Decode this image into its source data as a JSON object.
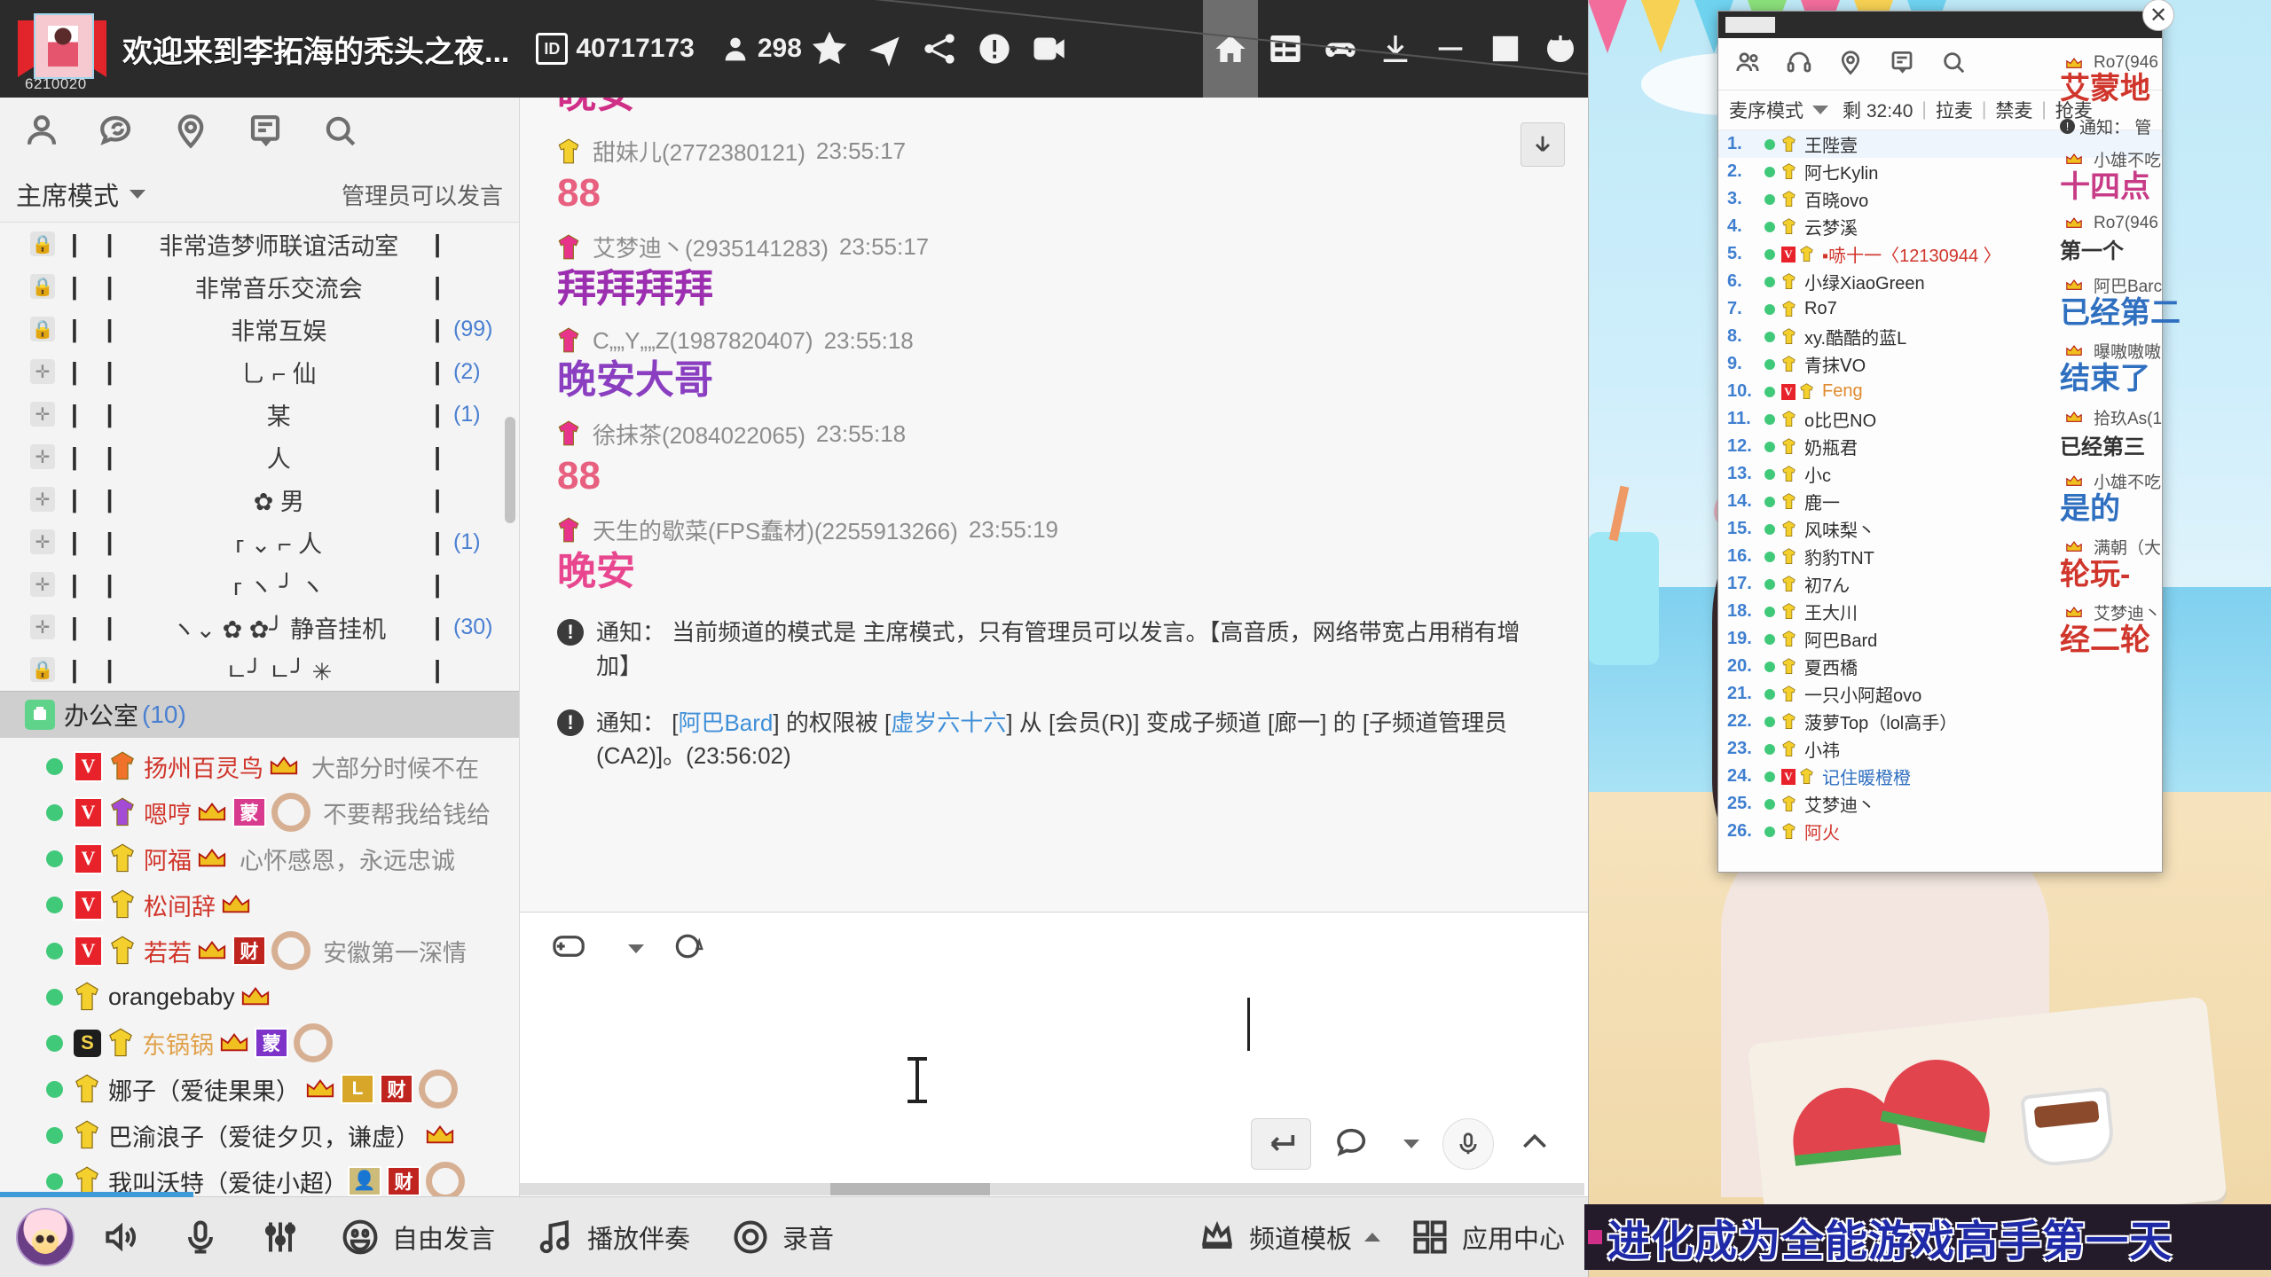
{
  "titlebar": {
    "room_title": "欢迎来到李拓海的秃头之夜...",
    "id_label": "ID",
    "room_id": "40717173",
    "member_count": "298",
    "uid_watermark": "6210020",
    "icons": [
      "star-icon",
      "airplane-icon",
      "share-icon",
      "report-icon",
      "video-icon",
      "home-icon",
      "list-icon",
      "gamepad-icon",
      "download-icon",
      "minimize-icon",
      "maximize-icon",
      "power-icon"
    ]
  },
  "sidebar": {
    "icons": [
      "person-icon",
      "chat-sync-icon",
      "location-pin-icon",
      "note-icon",
      "search-icon"
    ],
    "mode": "主席模式",
    "admin_hint": "管理员可以发言",
    "channels": [
      {
        "lock": "lock",
        "bars": "| |",
        "name": "非常造梦师联谊活动室",
        "tail": "|",
        "count": ""
      },
      {
        "lock": "lock",
        "bars": "| |",
        "name": "非常音乐交流会",
        "tail": "|",
        "count": ""
      },
      {
        "lock": "lock",
        "bars": "| |",
        "name": "非常互娱",
        "tail": "|",
        "count": "(99)"
      },
      {
        "lock": "plus",
        "bars": "| |",
        "name": "乚          ⌐  仙",
        "tail": "|",
        "count": "(2)"
      },
      {
        "lock": "plus",
        "bars": "| |",
        "name": "某",
        "tail": "|",
        "count": "(1)"
      },
      {
        "lock": "plus",
        "bars": "| |",
        "name": "人",
        "tail": "|",
        "count": ""
      },
      {
        "lock": "plus",
        "bars": "| |",
        "name": "✿                男",
        "tail": "|",
        "count": ""
      },
      {
        "lock": "plus",
        "bars": "| |",
        "name": "г  ⌄ ⌐          人",
        "tail": "|",
        "count": "(1)"
      },
      {
        "lock": "plus",
        "bars": "| |",
        "name": "г  ヽ      ╯  ヽ",
        "tail": "|",
        "count": ""
      },
      {
        "lock": "plus",
        "bars": "| |",
        "name": "ヽ⌄  ✿  ✿╯ 静音挂机",
        "tail": "|",
        "count": "(30)"
      },
      {
        "lock": "lock",
        "bars": "| |",
        "name": "ㄴ╯ ㄴ╯      ✳",
        "tail": "|",
        "count": ""
      }
    ],
    "office": {
      "label": "办公室",
      "count": "(10)"
    },
    "users": [
      {
        "v": "V",
        "robe": "#f0722a",
        "name": "扬州百灵鸟",
        "name_color": "#d0352b",
        "crown": true,
        "sig": "大部分时候不在",
        "badges": []
      },
      {
        "v": "V",
        "robe": "#a44bd6",
        "name": "嗯哼",
        "name_color": "#d0352b",
        "crown": true,
        "sig": "不要帮我给钱给",
        "badges": [
          {
            "t": "蒙",
            "bg": "#d83b8e"
          },
          {
            "t": "ring"
          }
        ]
      },
      {
        "v": "V",
        "robe": "#f3d02e",
        "name": "阿福",
        "name_color": "#d0352b",
        "crown": true,
        "sig": "心怀感恩，永远忠诚",
        "badges": []
      },
      {
        "v": "V",
        "robe": "#f3d02e",
        "name": "松间辞",
        "name_color": "#d0352b",
        "crown": true,
        "sig": "",
        "badges": []
      },
      {
        "v": "V",
        "robe": "#f3d02e",
        "name": "若若",
        "name_color": "#d0352b",
        "crown": true,
        "sig": "安徽第一深情",
        "badges": [
          {
            "t": "财",
            "bg": "#c0241f"
          },
          {
            "t": "ring"
          }
        ]
      },
      {
        "v": "",
        "robe": "#f3d02e",
        "name": "orangebaby",
        "name_color": "#2b2b2b",
        "crown": true,
        "sig": "",
        "badges": []
      },
      {
        "v": "S",
        "robe": "#f3d02e",
        "name": "东锅锅",
        "name_color": "#e0a14a",
        "crown": true,
        "sig": "",
        "badges": [
          {
            "t": "蒙",
            "bg": "#7e34c9"
          },
          {
            "t": "ring"
          }
        ]
      },
      {
        "v": "",
        "robe": "#f3d02e",
        "name": "娜子（爱徒果果）",
        "name_color": "#2b2b2b",
        "crown": true,
        "sig": "",
        "badges": [
          {
            "t": "L",
            "bg": "#d8a72a"
          },
          {
            "t": "财",
            "bg": "#c0241f"
          },
          {
            "t": "ring"
          }
        ]
      },
      {
        "v": "",
        "robe": "#f3d02e",
        "name": "巴渝浪子（爱徒夕贝，谦虚）",
        "name_color": "#2b2b2b",
        "crown": true,
        "sig": "",
        "badges": []
      },
      {
        "v": "",
        "robe": "#f3d02e",
        "name": "我叫沃特（爱徒小超）",
        "name_color": "#2b2b2b",
        "crown": false,
        "sig": "",
        "badges": [
          {
            "t": "👤",
            "bg": "#cdbb7a"
          },
          {
            "t": "财",
            "bg": "#c0241f"
          },
          {
            "t": "ring"
          }
        ]
      }
    ]
  },
  "chat": {
    "clipped_top": "晚安",
    "messages": [
      {
        "robe": "#f3d02e",
        "name": "甜妹儿(2772380121)",
        "time": "23:55:17",
        "text": "88",
        "color": "#e8607f"
      },
      {
        "robe": "#e8338a",
        "name": "艾梦迪丶(2935141283)",
        "time": "23:55:17",
        "text": "拜拜拜拜",
        "color": "#9c2fb0"
      },
      {
        "robe": "#e8338a",
        "name": "C„„Y„„Z(1987820407)",
        "time": "23:55:18",
        "text": "晚安大哥",
        "color": "#8a3ec0"
      },
      {
        "robe": "#e8338a",
        "name": "徐抹茶(2084022065)",
        "time": "23:55:18",
        "text": "88",
        "color": "#e8607f"
      },
      {
        "robe": "#e8338a",
        "name": "天生的歇菜(FPS蠢材)(2255913266)",
        "time": "23:55:19",
        "text": "晚安",
        "color": "#e8478f"
      }
    ],
    "notices": [
      {
        "label": "通知：",
        "text": "当前频道的模式是 主席模式，只有管理员可以发言。【高音质，网络带宽占用稍有增加】"
      },
      {
        "label": "通知：",
        "prefix": " [",
        "link1": "阿巴Bard",
        "mid": "] 的权限被 [",
        "link2": "虚岁六十六",
        "suffix": "] 从 [会员(R)] 变成子频道 [廊一] 的 [子频道管理员(CA2)]。(23:56:02)"
      }
    ],
    "scroll_down_icon": "arrow-down-icon"
  },
  "composer": {
    "emoji_icon": "gamepad-emoji-icon",
    "font_icon": "font-color-icon",
    "send_icon": "enter-send-icon",
    "bubble_icon": "speech-bubble-icon",
    "mic_icon": "microphone-icon",
    "collapse_icon": "chevron-up-icon",
    "input_value": "",
    "input_placeholder": ""
  },
  "bottombar": {
    "items": [
      {
        "icon": "speaker-icon",
        "label": ""
      },
      {
        "icon": "microphone-icon",
        "label": ""
      },
      {
        "icon": "mixer-icon",
        "label": ""
      },
      {
        "icon": "smiley-icon",
        "label": "自由发言"
      },
      {
        "icon": "music-note-icon",
        "label": "播放伴奏"
      },
      {
        "icon": "record-icon",
        "label": "录音"
      }
    ],
    "right": [
      {
        "icon": "crown-template-icon",
        "label": "频道模板"
      },
      {
        "icon": "grid-icon",
        "label": "应用中心"
      }
    ]
  },
  "rankwin": {
    "icons": [
      "people-icon",
      "mic-headset-icon",
      "location-pin-icon",
      "note-icon",
      "search-icon"
    ],
    "mode": "麦序模式",
    "timer": "剩 32:40",
    "actions": [
      "拉麦",
      "禁麦",
      "抢麦"
    ],
    "close_icon": "close-icon",
    "rows": [
      {
        "rank": "1.",
        "name": "王陛壹",
        "cls": "",
        "v": false,
        "hl": true
      },
      {
        "rank": "2.",
        "name": "阿七Kylin",
        "cls": "",
        "v": false
      },
      {
        "rank": "3.",
        "name": "百晓ovo",
        "cls": "",
        "v": false
      },
      {
        "rank": "4.",
        "name": "云梦溪",
        "cls": "",
        "v": false
      },
      {
        "rank": "5.",
        "name": "▪哧十一〈12130944 〉",
        "cls": "red",
        "v": true
      },
      {
        "rank": "6.",
        "name": "小绿XiaoGreen",
        "cls": "",
        "v": false
      },
      {
        "rank": "7.",
        "name": "Ro7",
        "cls": "",
        "v": false
      },
      {
        "rank": "8.",
        "name": "xy.酷酷的蓝L",
        "cls": "",
        "v": false
      },
      {
        "rank": "9.",
        "name": "青抹ⅤO",
        "cls": "",
        "v": false
      },
      {
        "rank": "10.",
        "name": "Feng",
        "cls": "org",
        "v": true
      },
      {
        "rank": "11.",
        "name": "o比巴ΝO",
        "cls": "",
        "v": false
      },
      {
        "rank": "12.",
        "name": "奶瓶君",
        "cls": "",
        "v": false
      },
      {
        "rank": "13.",
        "name": "小c",
        "cls": "",
        "v": false
      },
      {
        "rank": "14.",
        "name": "鹿一",
        "cls": "",
        "v": false
      },
      {
        "rank": "15.",
        "name": "风味梨丶",
        "cls": "",
        "v": false
      },
      {
        "rank": "16.",
        "name": "豹豹TNT",
        "cls": "",
        "v": false
      },
      {
        "rank": "17.",
        "name": "初7ん",
        "cls": "",
        "v": false
      },
      {
        "rank": "18.",
        "name": "王大川",
        "cls": "",
        "v": false
      },
      {
        "rank": "19.",
        "name": "阿巴Bard",
        "cls": "",
        "v": false
      },
      {
        "rank": "20.",
        "name": "夏西橋",
        "cls": "",
        "v": false
      },
      {
        "rank": "21.",
        "name": "一只小阿超ovo",
        "cls": "",
        "v": false
      },
      {
        "rank": "22.",
        "name": "菠萝Top（lol高手）",
        "cls": "",
        "v": false
      },
      {
        "rank": "23.",
        "name": "小祎",
        "cls": "",
        "v": false
      },
      {
        "rank": "24.",
        "name": "记住暖橙橙",
        "cls": "blu",
        "v": true
      },
      {
        "rank": "25.",
        "name": "艾梦迪丶",
        "cls": "",
        "v": false
      },
      {
        "rank": "26.",
        "name": "阿火",
        "cls": "red",
        "v": false
      }
    ]
  },
  "giftcol": {
    "items": [
      {
        "head": "Ro7(946",
        "big": "艾蒙地",
        "bigcls": "",
        "note": ""
      },
      {
        "note_label": "通知：",
        "note_text": "管"
      },
      {
        "head": "小雄不吃",
        "big": "十四点",
        "bigcls": "p"
      },
      {
        "head": "Ro7(946",
        "big": "第一个",
        "bigcls": "",
        "small": true
      },
      {
        "head": "阿巴Barc",
        "big": "已经第二",
        "bigcls": "b"
      },
      {
        "head": "曝嗷嗷嗷",
        "big": "结束了",
        "bigcls": "b"
      },
      {
        "head": "拾玖As(1",
        "big": "已经第三",
        "bigcls": "",
        "small": true
      },
      {
        "head": "小雄不吃",
        "big": "是的",
        "bigcls": "b"
      },
      {
        "head": "满朝（大",
        "big": "轮玩-",
        "bigcls": ""
      },
      {
        "head": "艾梦迪丶",
        "big": "经二轮",
        "bigcls": ""
      }
    ]
  },
  "banner": {
    "text": "进化成为全能游戏高手第一天"
  }
}
